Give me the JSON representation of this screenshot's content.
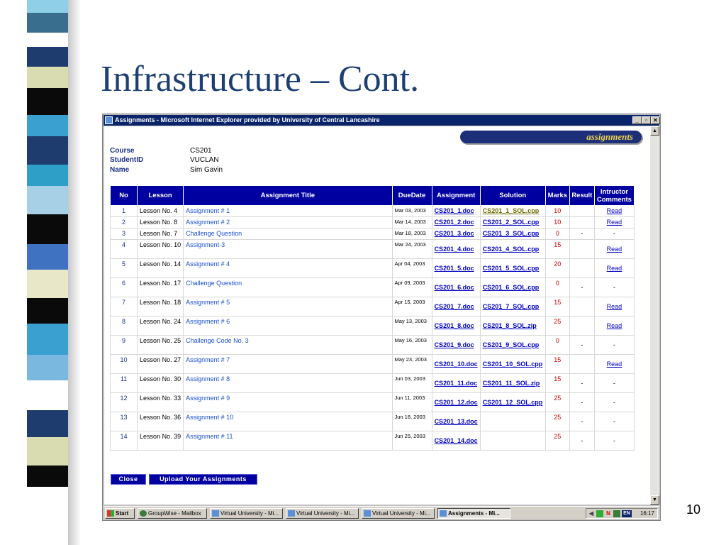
{
  "slide": {
    "title": "Infrastructure – Cont.",
    "number": "10"
  },
  "window": {
    "title": "Assignments - Microsoft Internet Explorer provided by University of Central Lancashire",
    "minimize_label": "_",
    "maximize_label": "▫",
    "close_label": "✕"
  },
  "banner": {
    "text": "assignments"
  },
  "info": {
    "course_label": "Course",
    "course_value": "CS201",
    "studentid_label": "StudentID",
    "studentid_value": "VUCLAN",
    "name_label": "Name",
    "name_value": "Sim Gavin"
  },
  "table": {
    "headers": [
      "No",
      "Lesson",
      "Assignment Title",
      "DueDate",
      "Assignment",
      "Solution",
      "Marks",
      "Result",
      "Intructor Comments"
    ],
    "rows": [
      {
        "no": "1",
        "lesson": "Lesson No. 4",
        "title": "Assignment # 1",
        "due": "Mar 03, 2003",
        "assignment": "CS201_1.doc",
        "solution": "CS201_1_SOL.cpp",
        "marks": "10",
        "result": "",
        "comments": "Read"
      },
      {
        "no": "2",
        "lesson": "Lesson No. 8",
        "title": "Assignment # 2",
        "due": "Mar 14, 2003",
        "assignment": "CS201_2.doc",
        "solution": "CS201_2_SOL.cpp",
        "marks": "10",
        "result": "",
        "comments": "Read"
      },
      {
        "no": "3",
        "lesson": "Lesson No. 7",
        "title": "Challenge Question",
        "due": "Mar 18, 2003",
        "assignment": "CS201_3.doc",
        "solution": "CS201_3_SOL.cpp",
        "marks": "0",
        "result": "-",
        "comments": "-"
      },
      {
        "no": "4",
        "lesson": "Lesson No. 10",
        "title": "Assignment-3",
        "due": "Mar 24, 2003",
        "assignment": "CS201_4.doc",
        "solution": "CS201_4_SOL.cpp",
        "marks": "15",
        "result": "",
        "comments": "Read"
      },
      {
        "no": "5",
        "lesson": "Lesson No. 14",
        "title": "Assignment # 4",
        "due": "Apr 04, 2003",
        "assignment": "CS201_5.doc",
        "solution": "CS201_5_SOL.cpp",
        "marks": "20",
        "result": "",
        "comments": "Read"
      },
      {
        "no": "6",
        "lesson": "Lesson No. 17",
        "title": "Challenge Question",
        "due": "Apr 09, 2003",
        "assignment": "CS201_6.doc",
        "solution": "CS201_6_SOL.cpp",
        "marks": "0",
        "result": "-",
        "comments": "-"
      },
      {
        "no": "7",
        "lesson": "Lesson No. 18",
        "title": "Assignment # 5",
        "due": "Apr 15, 2003",
        "assignment": "CS201_7.doc",
        "solution": "CS201_7_SOL.cpp",
        "marks": "15",
        "result": "",
        "comments": "Read"
      },
      {
        "no": "8",
        "lesson": "Lesson No. 24",
        "title": "Assignment # 6",
        "due": "May 13, 2003",
        "assignment": "CS201_8.doc",
        "solution": "CS201_8_SOL.zip",
        "marks": "25",
        "result": "",
        "comments": "Read"
      },
      {
        "no": "9",
        "lesson": "Lesson No. 25",
        "title": "Challenge Code No. 3",
        "due": "May 16, 2003",
        "assignment": "CS201_9.doc",
        "solution": "CS201_9_SOL.cpp",
        "marks": "0",
        "result": "-",
        "comments": "-"
      },
      {
        "no": "10",
        "lesson": "Lesson No. 27",
        "title": "Assignment # 7",
        "due": "May 23, 2003",
        "assignment": "CS201_10.doc",
        "solution": "CS201_10_SOL.cpp",
        "marks": "15",
        "result": "",
        "comments": "Read"
      },
      {
        "no": "11",
        "lesson": "Lesson No. 30",
        "title": "Assignment # 8",
        "due": "Jun 03, 2003",
        "assignment": "CS201_11.doc",
        "solution": "CS201_11_SOL.zip",
        "marks": "15",
        "result": "-",
        "comments": "-"
      },
      {
        "no": "12",
        "lesson": "Lesson No. 33",
        "title": "Assignment # 9",
        "due": "Jun 11, 2003",
        "assignment": "CS201_12.doc",
        "solution": "CS201_12_SOL.cpp",
        "marks": "25",
        "result": "-",
        "comments": "-"
      },
      {
        "no": "13",
        "lesson": "Lesson No. 36",
        "title": "Assignment # 10",
        "due": "Jun 18, 2003",
        "assignment": "CS201_13.doc",
        "solution": "",
        "marks": "25",
        "result": "-",
        "comments": "-"
      },
      {
        "no": "14",
        "lesson": "Lesson No. 39",
        "title": "Assignment # 11",
        "due": "Jun 25, 2003",
        "assignment": "CS201_14.doc",
        "solution": "",
        "marks": "25",
        "result": "-",
        "comments": "-"
      }
    ]
  },
  "buttons": {
    "close": "Close",
    "upload": "Upload Your Assignments"
  },
  "taskbar": {
    "start": "Start",
    "items": [
      "GroupWise - Mailbox",
      "Virtual University - Mi...",
      "Virtual University - Mi...",
      "Virtual University - Mi...",
      "Assignments - Mi..."
    ],
    "tray_n": "N",
    "tray_lang": "EN",
    "clock": "16:17"
  },
  "colors": {
    "slide_title": "#1d3f73",
    "header_bg": "#0000a0",
    "banner_bg": "#1d2f78",
    "banner_text": "#f0d24a",
    "marks": "#cc0000",
    "stripe": [
      "#8fd0e8",
      "#3a6e8f",
      "#ffffff",
      "#1e3c6e",
      "#d9dbb0",
      "#0a0a0a",
      "#3aa0d0",
      "#1e3c6e",
      "#2ea0c8",
      "#a7cfe6",
      "#0a0a0a",
      "#3f72c0",
      "#e8e8c8",
      "#0a0a0a",
      "#3aa0d0",
      "#7bb8e0",
      "#ffffff",
      "#1e3c6e",
      "#d9dbb0",
      "#0a0a0a"
    ]
  }
}
